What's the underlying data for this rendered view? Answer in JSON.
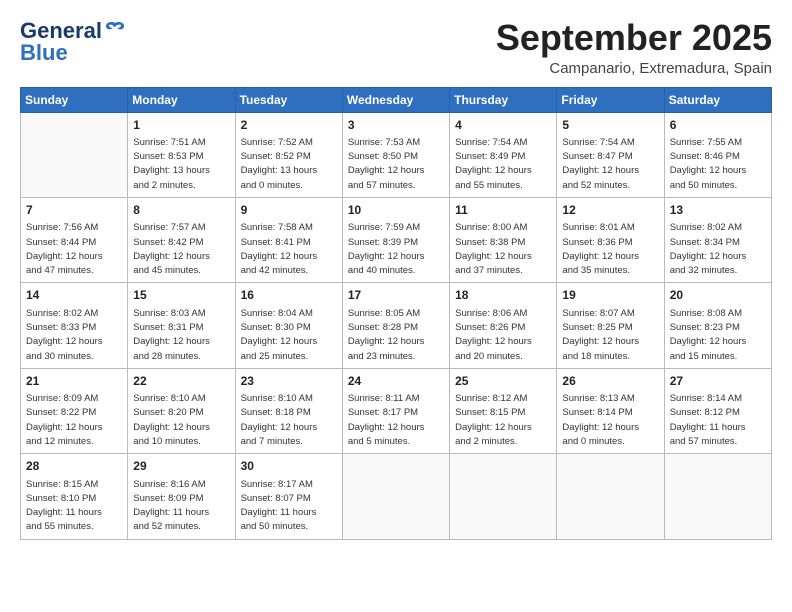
{
  "logo": {
    "general": "General",
    "blue": "Blue"
  },
  "title": "September 2025",
  "subtitle": "Campanario, Extremadura, Spain",
  "days_of_week": [
    "Sunday",
    "Monday",
    "Tuesday",
    "Wednesday",
    "Thursday",
    "Friday",
    "Saturday"
  ],
  "weeks": [
    [
      {
        "day": "",
        "info": ""
      },
      {
        "day": "1",
        "info": "Sunrise: 7:51 AM\nSunset: 8:53 PM\nDaylight: 13 hours\nand 2 minutes."
      },
      {
        "day": "2",
        "info": "Sunrise: 7:52 AM\nSunset: 8:52 PM\nDaylight: 13 hours\nand 0 minutes."
      },
      {
        "day": "3",
        "info": "Sunrise: 7:53 AM\nSunset: 8:50 PM\nDaylight: 12 hours\nand 57 minutes."
      },
      {
        "day": "4",
        "info": "Sunrise: 7:54 AM\nSunset: 8:49 PM\nDaylight: 12 hours\nand 55 minutes."
      },
      {
        "day": "5",
        "info": "Sunrise: 7:54 AM\nSunset: 8:47 PM\nDaylight: 12 hours\nand 52 minutes."
      },
      {
        "day": "6",
        "info": "Sunrise: 7:55 AM\nSunset: 8:46 PM\nDaylight: 12 hours\nand 50 minutes."
      }
    ],
    [
      {
        "day": "7",
        "info": "Sunrise: 7:56 AM\nSunset: 8:44 PM\nDaylight: 12 hours\nand 47 minutes."
      },
      {
        "day": "8",
        "info": "Sunrise: 7:57 AM\nSunset: 8:42 PM\nDaylight: 12 hours\nand 45 minutes."
      },
      {
        "day": "9",
        "info": "Sunrise: 7:58 AM\nSunset: 8:41 PM\nDaylight: 12 hours\nand 42 minutes."
      },
      {
        "day": "10",
        "info": "Sunrise: 7:59 AM\nSunset: 8:39 PM\nDaylight: 12 hours\nand 40 minutes."
      },
      {
        "day": "11",
        "info": "Sunrise: 8:00 AM\nSunset: 8:38 PM\nDaylight: 12 hours\nand 37 minutes."
      },
      {
        "day": "12",
        "info": "Sunrise: 8:01 AM\nSunset: 8:36 PM\nDaylight: 12 hours\nand 35 minutes."
      },
      {
        "day": "13",
        "info": "Sunrise: 8:02 AM\nSunset: 8:34 PM\nDaylight: 12 hours\nand 32 minutes."
      }
    ],
    [
      {
        "day": "14",
        "info": "Sunrise: 8:02 AM\nSunset: 8:33 PM\nDaylight: 12 hours\nand 30 minutes."
      },
      {
        "day": "15",
        "info": "Sunrise: 8:03 AM\nSunset: 8:31 PM\nDaylight: 12 hours\nand 28 minutes."
      },
      {
        "day": "16",
        "info": "Sunrise: 8:04 AM\nSunset: 8:30 PM\nDaylight: 12 hours\nand 25 minutes."
      },
      {
        "day": "17",
        "info": "Sunrise: 8:05 AM\nSunset: 8:28 PM\nDaylight: 12 hours\nand 23 minutes."
      },
      {
        "day": "18",
        "info": "Sunrise: 8:06 AM\nSunset: 8:26 PM\nDaylight: 12 hours\nand 20 minutes."
      },
      {
        "day": "19",
        "info": "Sunrise: 8:07 AM\nSunset: 8:25 PM\nDaylight: 12 hours\nand 18 minutes."
      },
      {
        "day": "20",
        "info": "Sunrise: 8:08 AM\nSunset: 8:23 PM\nDaylight: 12 hours\nand 15 minutes."
      }
    ],
    [
      {
        "day": "21",
        "info": "Sunrise: 8:09 AM\nSunset: 8:22 PM\nDaylight: 12 hours\nand 12 minutes."
      },
      {
        "day": "22",
        "info": "Sunrise: 8:10 AM\nSunset: 8:20 PM\nDaylight: 12 hours\nand 10 minutes."
      },
      {
        "day": "23",
        "info": "Sunrise: 8:10 AM\nSunset: 8:18 PM\nDaylight: 12 hours\nand 7 minutes."
      },
      {
        "day": "24",
        "info": "Sunrise: 8:11 AM\nSunset: 8:17 PM\nDaylight: 12 hours\nand 5 minutes."
      },
      {
        "day": "25",
        "info": "Sunrise: 8:12 AM\nSunset: 8:15 PM\nDaylight: 12 hours\nand 2 minutes."
      },
      {
        "day": "26",
        "info": "Sunrise: 8:13 AM\nSunset: 8:14 PM\nDaylight: 12 hours\nand 0 minutes."
      },
      {
        "day": "27",
        "info": "Sunrise: 8:14 AM\nSunset: 8:12 PM\nDaylight: 11 hours\nand 57 minutes."
      }
    ],
    [
      {
        "day": "28",
        "info": "Sunrise: 8:15 AM\nSunset: 8:10 PM\nDaylight: 11 hours\nand 55 minutes."
      },
      {
        "day": "29",
        "info": "Sunrise: 8:16 AM\nSunset: 8:09 PM\nDaylight: 11 hours\nand 52 minutes."
      },
      {
        "day": "30",
        "info": "Sunrise: 8:17 AM\nSunset: 8:07 PM\nDaylight: 11 hours\nand 50 minutes."
      },
      {
        "day": "",
        "info": ""
      },
      {
        "day": "",
        "info": ""
      },
      {
        "day": "",
        "info": ""
      },
      {
        "day": "",
        "info": ""
      }
    ]
  ]
}
